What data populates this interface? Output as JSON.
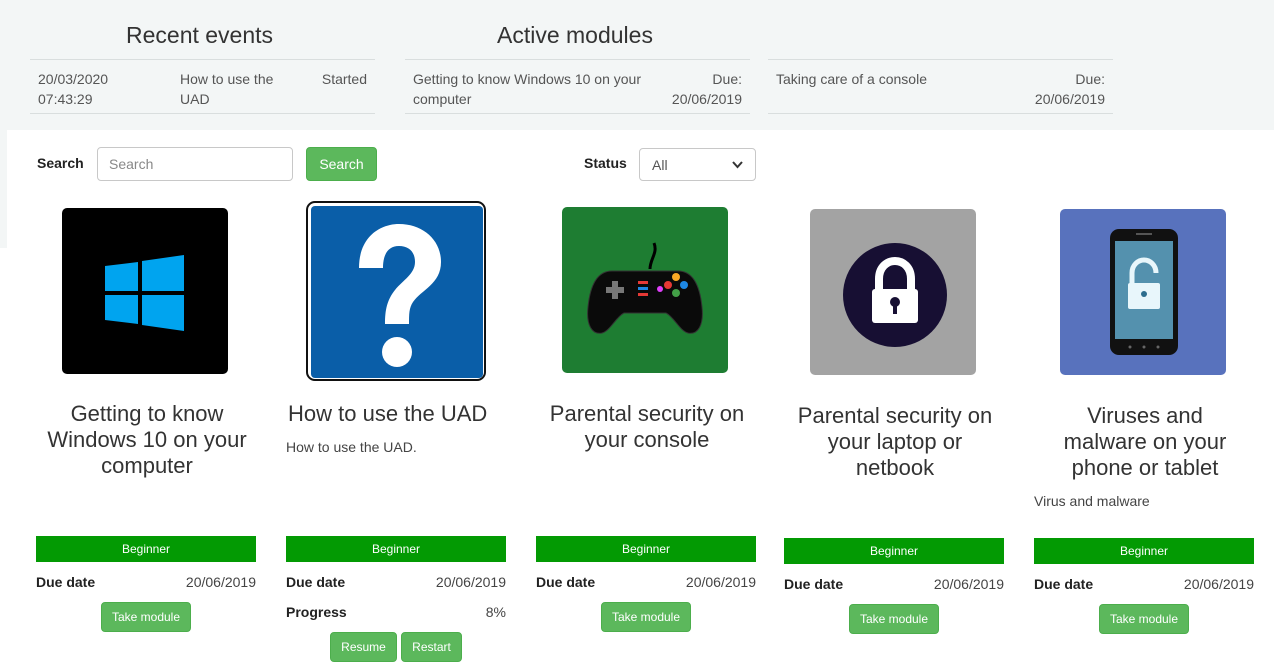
{
  "recent_events": {
    "title": "Recent events",
    "items": [
      {
        "date": "20/03/2020",
        "time": "07:43:29",
        "name_line1": "How to use the",
        "name_line2": "UAD",
        "status": "Started"
      }
    ]
  },
  "active_modules": {
    "title": "Active modules",
    "items": [
      {
        "name_line1": "Getting to know Windows 10 on your",
        "name_line2": "computer",
        "due_label": "Due:",
        "due_date": "20/06/2019"
      },
      {
        "name_line1": "Taking care of a console",
        "name_line2": "",
        "due_label": "Due:",
        "due_date": "20/06/2019"
      }
    ]
  },
  "filters": {
    "search_label": "Search",
    "search_placeholder": "Search",
    "search_button": "Search",
    "status_label": "Status",
    "status_selected": "All"
  },
  "modules": [
    {
      "title_lines": [
        "Getting to know",
        "Windows 10 on your",
        "computer"
      ],
      "description": "",
      "level": "Beginner",
      "due_label": "Due date",
      "due_date": "20/06/2019",
      "button": "Take module",
      "icon": "windows-logo-icon",
      "icon_bg": "#000000"
    },
    {
      "title_lines": [
        "How to use the UAD"
      ],
      "description": "How to use the UAD.",
      "level": "Beginner",
      "due_label": "Due date",
      "due_date": "20/06/2019",
      "progress_label": "Progress",
      "progress_value": "8%",
      "resume_button": "Resume",
      "restart_button": "Restart",
      "icon": "question-mark-icon",
      "icon_bg": "#0a5ea8"
    },
    {
      "title_lines": [
        "Parental security on",
        "your console"
      ],
      "description": "",
      "level": "Beginner",
      "due_label": "Due date",
      "due_date": "20/06/2019",
      "button": "Take module",
      "icon": "gamepad-icon",
      "icon_bg": "#1e7d32"
    },
    {
      "title_lines": [
        "Parental security on",
        "your laptop or",
        "netbook"
      ],
      "description": "",
      "level": "Beginner",
      "due_label": "Due date",
      "due_date": "20/06/2019",
      "button": "Take module",
      "icon": "padlock-icon",
      "icon_bg": "#a3a3a3"
    },
    {
      "title_lines": [
        "Viruses and",
        "malware on your",
        "phone or tablet"
      ],
      "description": "Virus and malware",
      "level": "Beginner",
      "due_label": "Due date",
      "due_date": "20/06/2019",
      "button": "Take module",
      "icon": "phone-lock-icon",
      "icon_bg": "#5872bd"
    }
  ],
  "colors": {
    "accent_green": "#5cb85c",
    "level_green": "#039a03",
    "band_bg": "#f3f6f6"
  }
}
